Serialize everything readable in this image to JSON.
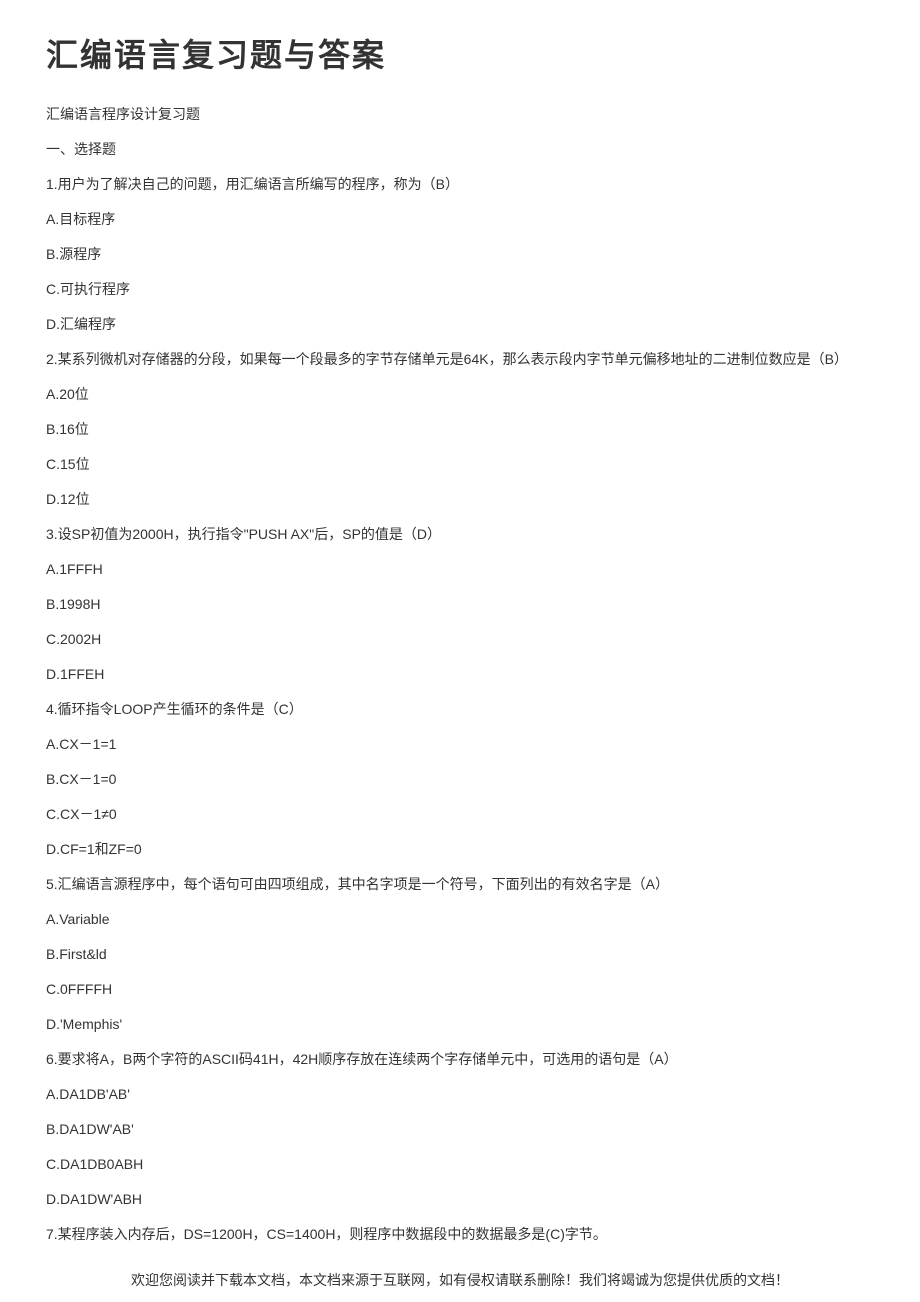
{
  "title": "汇编语言复习题与答案",
  "lines": [
    "汇编语言程序设计复习题",
    "一、选择题",
    "1.用户为了解决自己的问题，用汇编语言所编写的程序，称为（B）",
    "A.目标程序",
    "B.源程序",
    "C.可执行程序",
    "D.汇编程序",
    "2.某系列微机对存储器的分段，如果每一个段最多的字节存储单元是64K，那么表示段内字节单元偏移地址的二进制位数应是（B）",
    "A.20位",
    "B.16位",
    "C.15位",
    "D.12位",
    "3.设SP初值为2000H，执行指令\"PUSH AX\"后，SP的值是（D）",
    "A.1FFFH",
    "B.1998H",
    "C.2002H",
    "D.1FFEH",
    "4.循环指令LOOP产生循环的条件是（C）",
    "A.CX－1=1",
    "B.CX－1=0",
    "C.CX－1≠0",
    "D.CF=1和ZF=0",
    "5.汇编语言源程序中，每个语句可由四项组成，其中名字项是一个符号，下面列出的有效名字是（A）",
    "A.Variable",
    "B.First&ld",
    "C.0FFFFH",
    "D.'Memphis'",
    "6.要求将A，B两个字符的ASCII码41H，42H顺序存放在连续两个字存储单元中，可选用的语句是（A）",
    "A.DA1DB'AB'",
    "B.DA1DW'AB'",
    "C.DA1DB0ABH",
    "D.DA1DW'ABH",
    "7.某程序装入内存后，DS=1200H，CS=1400H，则程序中数据段中的数据最多是(C)字节。"
  ],
  "footer": "欢迎您阅读并下载本文档，本文档来源于互联网，如有侵权请联系删除！我们将竭诚为您提供优质的文档！"
}
